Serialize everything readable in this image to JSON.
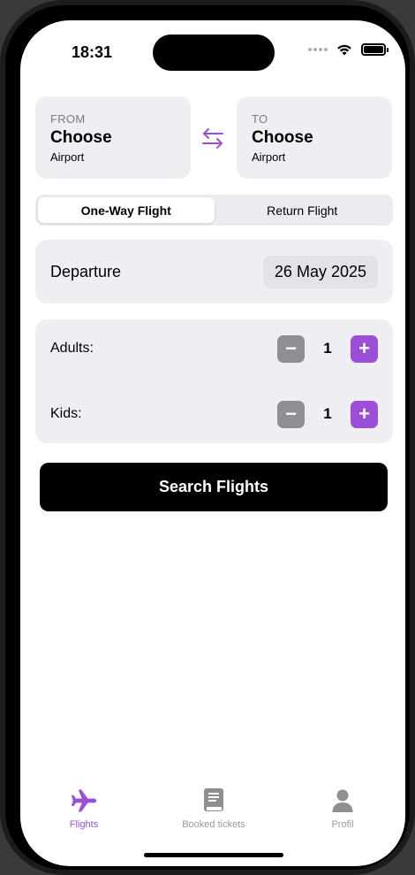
{
  "status_bar": {
    "time": "18:31"
  },
  "route": {
    "from": {
      "tag": "FROM",
      "title": "Choose",
      "subtitle": "Airport"
    },
    "to": {
      "tag": "TO",
      "title": "Choose",
      "subtitle": "Airport"
    }
  },
  "trip_type": {
    "options": [
      "One-Way Flight",
      "Return Flight"
    ],
    "selected": "One-Way Flight"
  },
  "departure": {
    "label": "Departure",
    "date": "26 May 2025"
  },
  "passengers": {
    "adults": {
      "label": "Adults:",
      "value": "1",
      "minus": "−",
      "plus": "+"
    },
    "kids": {
      "label": "Kids:",
      "value": "1",
      "minus": "−",
      "plus": "+"
    }
  },
  "search_button": {
    "label": "Search Flights"
  },
  "tabbar": {
    "items": [
      {
        "label": "Flights",
        "icon": "airplane-icon",
        "active": true
      },
      {
        "label": "Booked tickets",
        "icon": "book-icon",
        "active": false
      },
      {
        "label": "Profil",
        "icon": "person-icon",
        "active": false
      }
    ]
  },
  "colors": {
    "accent": "#9b4fd9",
    "card_bg": "#efeef3",
    "minus_gray": "#8e8e93"
  }
}
